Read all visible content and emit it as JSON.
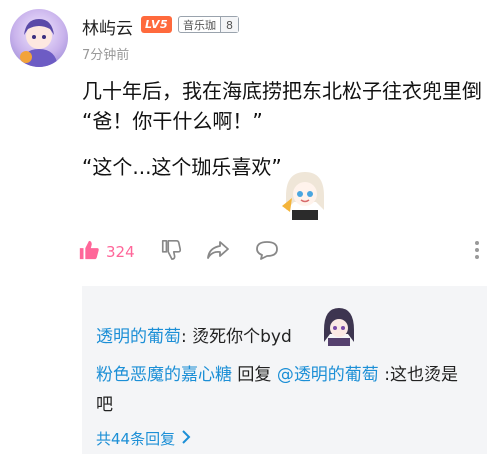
{
  "comment": {
    "username": "林屿云",
    "level_badge": "LV5",
    "fan_badge_name": "音乐珈",
    "fan_badge_level": "8",
    "time": "7分钟前",
    "lines": [
      "几十年后，我在海底捞把东北松子往衣兜里倒",
      "“爸！你干什么啊！”",
      "“这个...这个珈乐喜欢”"
    ],
    "like_count": "324"
  },
  "replies": {
    "first": {
      "author": "透明的葡萄",
      "separator": ": ",
      "text": "烫死你个byd"
    },
    "second": {
      "author": "粉色恶魔的嘉心糖",
      "reply_word": " 回复 ",
      "mention": "@透明的葡萄",
      "text": " :这也烫是吧"
    },
    "more_label": "共44条回复"
  },
  "colors": {
    "accent_pink": "#ff6699",
    "link_blue": "#1c8fd6",
    "level_orange": "#ff6a3d"
  }
}
